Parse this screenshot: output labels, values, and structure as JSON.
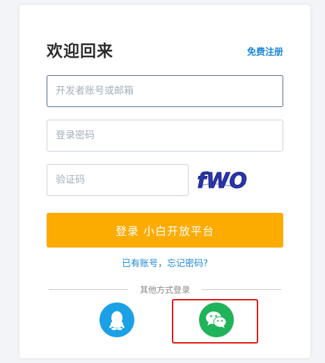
{
  "header": {
    "title": "欢迎回来",
    "register_label": "免费注册"
  },
  "form": {
    "username_placeholder": "开发者账号或邮箱",
    "password_placeholder": "登录密码",
    "captcha_placeholder": "验证码",
    "captcha_text": "fWO",
    "login_label": "登录 小白开放平台",
    "forgot_label": "已有账号，忘记密码?"
  },
  "social": {
    "divider_text": "其他方式登录",
    "providers": [
      {
        "name": "QQ",
        "icon": "qq-icon",
        "color": "#1ba0e6"
      },
      {
        "name": "WeChat",
        "icon": "wechat-icon",
        "color": "#21b35a",
        "highlighted": true
      }
    ]
  },
  "colors": {
    "accent": "#fcab00",
    "link": "#1e88d6",
    "highlight": "#e11616"
  }
}
